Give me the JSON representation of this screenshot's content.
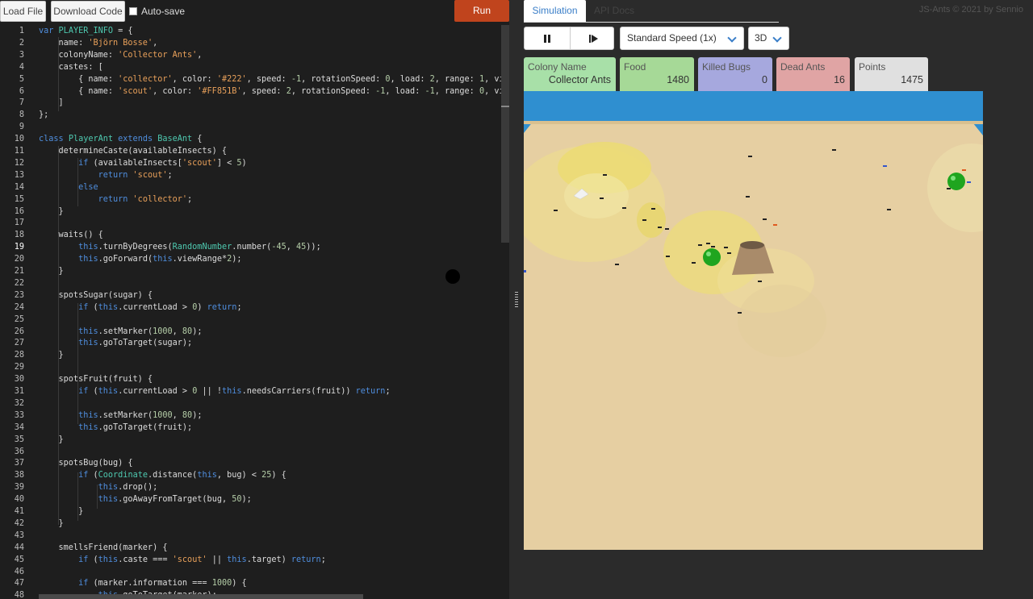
{
  "toolbar": {
    "load_file": "Load File",
    "download_code": "Download Code",
    "autosave_label": "Auto-save",
    "run_label": "Run"
  },
  "editor": {
    "active_line": 19,
    "lines": [
      [
        [
          "k",
          "var "
        ],
        [
          "t",
          "PLAYER_INFO"
        ],
        [
          "f",
          " = {"
        ]
      ],
      [
        [
          "f",
          "    name: "
        ],
        [
          "s",
          "'Björn Bosse'"
        ],
        [
          "f",
          ","
        ]
      ],
      [
        [
          "f",
          "    colonyName: "
        ],
        [
          "s",
          "'Collector Ants'"
        ],
        [
          "f",
          ","
        ]
      ],
      [
        [
          "f",
          "    castes: ["
        ]
      ],
      [
        [
          "f",
          "        { name: "
        ],
        [
          "s",
          "'collector'"
        ],
        [
          "f",
          ", color: "
        ],
        [
          "s",
          "'#222'"
        ],
        [
          "f",
          ", speed: "
        ],
        [
          "n",
          "-1"
        ],
        [
          "f",
          ", rotationSpeed: "
        ],
        [
          "n",
          "0"
        ],
        [
          "f",
          ", load: "
        ],
        [
          "n",
          "2"
        ],
        [
          "f",
          ", range: "
        ],
        [
          "n",
          "1"
        ],
        [
          "f",
          ", viewRa"
        ]
      ],
      [
        [
          "f",
          "        { name: "
        ],
        [
          "s",
          "'scout'"
        ],
        [
          "f",
          ", color: "
        ],
        [
          "s",
          "'#FF851B'"
        ],
        [
          "f",
          ", speed: "
        ],
        [
          "n",
          "2"
        ],
        [
          "f",
          ", rotationSpeed: "
        ],
        [
          "n",
          "-1"
        ],
        [
          "f",
          ", load: "
        ],
        [
          "n",
          "-1"
        ],
        [
          "f",
          ", range: "
        ],
        [
          "n",
          "0"
        ],
        [
          "f",
          ", viewRa"
        ]
      ],
      [
        [
          "f",
          "    ]"
        ]
      ],
      [
        [
          "f",
          "};"
        ]
      ],
      [],
      [
        [
          "k",
          "class "
        ],
        [
          "t",
          "PlayerAnt "
        ],
        [
          "k",
          "extends "
        ],
        [
          "t",
          "BaseAnt"
        ],
        [
          "f",
          " {"
        ]
      ],
      [
        [
          "f",
          "    determineCaste(availableInsects) {"
        ]
      ],
      [
        [
          "f",
          "        "
        ],
        [
          "k",
          "if"
        ],
        [
          "f",
          " (availableInsects["
        ],
        [
          "s",
          "'scout'"
        ],
        [
          "f",
          "] < "
        ],
        [
          "n",
          "5"
        ],
        [
          "f",
          ")"
        ]
      ],
      [
        [
          "f",
          "            "
        ],
        [
          "k",
          "return "
        ],
        [
          "s",
          "'scout'"
        ],
        [
          "f",
          ";"
        ]
      ],
      [
        [
          "f",
          "        "
        ],
        [
          "k",
          "else"
        ]
      ],
      [
        [
          "f",
          "            "
        ],
        [
          "k",
          "return "
        ],
        [
          "s",
          "'collector'"
        ],
        [
          "f",
          ";"
        ]
      ],
      [
        [
          "f",
          "    }"
        ]
      ],
      [],
      [
        [
          "f",
          "    waits() {"
        ]
      ],
      [
        [
          "f",
          "        "
        ],
        [
          "k",
          "this"
        ],
        [
          "f",
          ".turnByDegrees("
        ],
        [
          "t",
          "RandomNumber"
        ],
        [
          "f",
          ".number("
        ],
        [
          "n",
          "-45"
        ],
        [
          "f",
          ", "
        ],
        [
          "n",
          "45"
        ],
        [
          "f",
          "));"
        ]
      ],
      [
        [
          "f",
          "        "
        ],
        [
          "k",
          "this"
        ],
        [
          "f",
          ".goForward("
        ],
        [
          "k",
          "this"
        ],
        [
          "f",
          ".viewRange*"
        ],
        [
          "n",
          "2"
        ],
        [
          "f",
          ");"
        ]
      ],
      [
        [
          "f",
          "    }"
        ]
      ],
      [],
      [
        [
          "f",
          "    spotsSugar(sugar) {"
        ]
      ],
      [
        [
          "f",
          "        "
        ],
        [
          "k",
          "if"
        ],
        [
          "f",
          " ("
        ],
        [
          "k",
          "this"
        ],
        [
          "f",
          ".currentLoad > "
        ],
        [
          "n",
          "0"
        ],
        [
          "f",
          ") "
        ],
        [
          "k",
          "return"
        ],
        [
          "f",
          ";"
        ]
      ],
      [],
      [
        [
          "f",
          "        "
        ],
        [
          "k",
          "this"
        ],
        [
          "f",
          ".setMarker("
        ],
        [
          "n",
          "1000"
        ],
        [
          "f",
          ", "
        ],
        [
          "n",
          "80"
        ],
        [
          "f",
          ");"
        ]
      ],
      [
        [
          "f",
          "        "
        ],
        [
          "k",
          "this"
        ],
        [
          "f",
          ".goToTarget(sugar);"
        ]
      ],
      [
        [
          "f",
          "    }"
        ]
      ],
      [],
      [
        [
          "f",
          "    spotsFruit(fruit) {"
        ]
      ],
      [
        [
          "f",
          "        "
        ],
        [
          "k",
          "if"
        ],
        [
          "f",
          " ("
        ],
        [
          "k",
          "this"
        ],
        [
          "f",
          ".currentLoad > "
        ],
        [
          "n",
          "0"
        ],
        [
          "f",
          " || !"
        ],
        [
          "k",
          "this"
        ],
        [
          "f",
          ".needsCarriers(fruit)) "
        ],
        [
          "k",
          "return"
        ],
        [
          "f",
          ";"
        ]
      ],
      [],
      [
        [
          "f",
          "        "
        ],
        [
          "k",
          "this"
        ],
        [
          "f",
          ".setMarker("
        ],
        [
          "n",
          "1000"
        ],
        [
          "f",
          ", "
        ],
        [
          "n",
          "80"
        ],
        [
          "f",
          ");"
        ]
      ],
      [
        [
          "f",
          "        "
        ],
        [
          "k",
          "this"
        ],
        [
          "f",
          ".goToTarget(fruit);"
        ]
      ],
      [
        [
          "f",
          "    }"
        ]
      ],
      [],
      [
        [
          "f",
          "    spotsBug(bug) {"
        ]
      ],
      [
        [
          "f",
          "        "
        ],
        [
          "k",
          "if"
        ],
        [
          "f",
          " ("
        ],
        [
          "t",
          "Coordinate"
        ],
        [
          "f",
          ".distance("
        ],
        [
          "k",
          "this"
        ],
        [
          "f",
          ", bug) < "
        ],
        [
          "n",
          "25"
        ],
        [
          "f",
          ") {"
        ]
      ],
      [
        [
          "f",
          "            "
        ],
        [
          "k",
          "this"
        ],
        [
          "f",
          ".drop();"
        ]
      ],
      [
        [
          "f",
          "            "
        ],
        [
          "k",
          "this"
        ],
        [
          "f",
          ".goAwayFromTarget(bug, "
        ],
        [
          "n",
          "50"
        ],
        [
          "f",
          ");"
        ]
      ],
      [
        [
          "f",
          "        }"
        ]
      ],
      [
        [
          "f",
          "    }"
        ]
      ],
      [],
      [
        [
          "f",
          "    smellsFriend(marker) {"
        ]
      ],
      [
        [
          "f",
          "        "
        ],
        [
          "k",
          "if"
        ],
        [
          "f",
          " ("
        ],
        [
          "k",
          "this"
        ],
        [
          "f",
          ".caste === "
        ],
        [
          "s",
          "'scout'"
        ],
        [
          "f",
          " || "
        ],
        [
          "k",
          "this"
        ],
        [
          "f",
          ".target) "
        ],
        [
          "k",
          "return"
        ],
        [
          "f",
          ";"
        ]
      ],
      [],
      [
        [
          "f",
          "        "
        ],
        [
          "k",
          "if"
        ],
        [
          "f",
          " (marker.information === "
        ],
        [
          "n",
          "1000"
        ],
        [
          "f",
          ") {"
        ]
      ],
      [
        [
          "f",
          "            "
        ],
        [
          "k",
          "this"
        ],
        [
          "f",
          ".goToTarget(marker);"
        ]
      ]
    ]
  },
  "tabs": {
    "simulation": "Simulation",
    "api_docs": "API Docs"
  },
  "copyright": "JS-Ants © 2021 by Sennio",
  "controls": {
    "speed_selected": "Standard Speed (1x)",
    "view_selected": "3D"
  },
  "stats": {
    "colony": {
      "label": "Colony Name",
      "value": "Collector Ants"
    },
    "food": {
      "label": "Food",
      "value": "1480"
    },
    "killed_bugs": {
      "label": "Killed Bugs",
      "value": "0"
    },
    "dead_ants": {
      "label": "Dead Ants",
      "value": "16"
    },
    "points": {
      "label": "Points",
      "value": "1475"
    }
  },
  "colors": {
    "run": "#c0441d",
    "accent": "#3a7ec8",
    "sky": "#2f8fd0",
    "ground": "#e8d2a4",
    "apple": "#22aa22"
  }
}
